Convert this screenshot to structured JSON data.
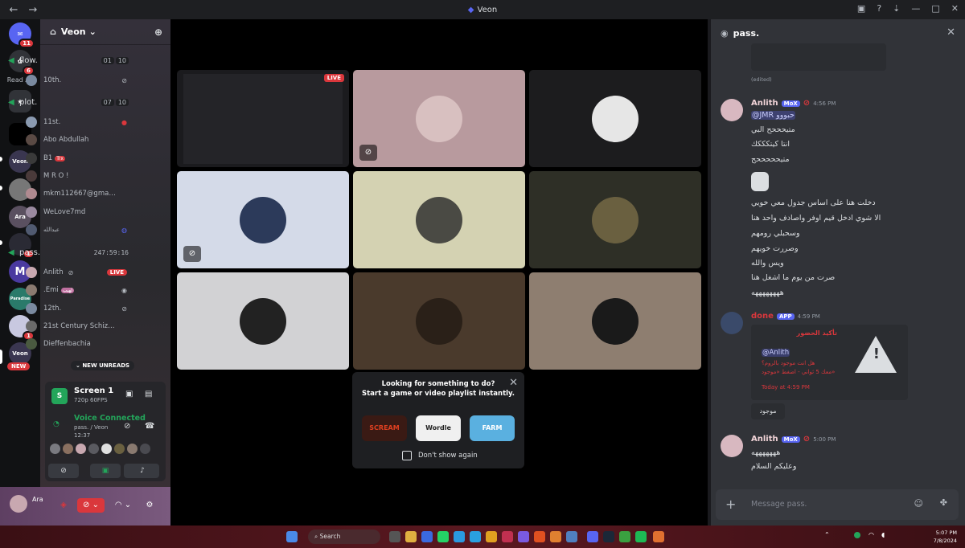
{
  "window": {
    "title": "Veon",
    "back": "←",
    "forward": "→"
  },
  "rail": {
    "readall": "Read All",
    "home_badge": "11",
    "second_badge": "6",
    "server_badges": [
      "1",
      "1"
    ],
    "new_label": "NEW",
    "labels": [
      "Veon",
      "Ara",
      "M",
      "Paradise",
      "Veon"
    ]
  },
  "server": {
    "name": "Veon"
  },
  "channels": {
    "flow": {
      "name": "flow.",
      "counts": [
        "01",
        "10"
      ]
    },
    "flow_members": [
      {
        "name": "10th."
      }
    ],
    "plot": {
      "name": "plot.",
      "counts": [
        "07",
        "10"
      ]
    },
    "plot_members": [
      {
        "name": "11st."
      },
      {
        "name": "Abo Abdullah"
      },
      {
        "name": "B1",
        "tag": "Trx"
      },
      {
        "name": "M R O !"
      },
      {
        "name": "mkm112667@gmail.c..."
      },
      {
        "name": "WeLove7md"
      },
      {
        "name": "عبدالله"
      }
    ],
    "pass": {
      "name": "pass.",
      "timer": "247:59:16"
    },
    "pass_members": [
      {
        "name": "Anlith",
        "live": "LIVE"
      },
      {
        "name": ".Emi",
        "tag": "لهيب"
      },
      {
        "name": "12th."
      },
      {
        "name": "21st Century Schizoi..."
      },
      {
        "name": "Dieffenbachia"
      }
    ],
    "new_unreads": "NEW UNREADS"
  },
  "stream_panel": {
    "thumb": "S",
    "title": "Screen 1",
    "quality": "720p 60FPS",
    "voice_status": "Voice Connected",
    "voice_channel": "pass. / Veon",
    "elapsed": "12:37"
  },
  "user": {
    "name": "Ara"
  },
  "stage": {
    "live_label": "LIVE",
    "tiles": [
      {
        "kind": "screenshare",
        "bg": "#1b1b1e"
      },
      {
        "kind": "avatar",
        "bg": "#b89a9e",
        "avatar_bg": "#d8c0c0"
      },
      {
        "kind": "avatar",
        "bg": "#1c1c1e",
        "avatar_bg": "#e6e6e6"
      },
      {
        "kind": "avatar",
        "bg": "#d4dae8",
        "avatar_bg": "#2c3a5a"
      },
      {
        "kind": "avatar",
        "bg": "#d4d2b2",
        "avatar_bg": "#4a4a44"
      },
      {
        "kind": "avatar",
        "bg": "#2e2f26",
        "avatar_bg": "#6a6040"
      },
      {
        "kind": "avatar",
        "bg": "#d2d2d4",
        "avatar_bg": "#222222"
      },
      {
        "kind": "avatar",
        "bg": "#4a3a2c",
        "avatar_bg": "#2a2018"
      },
      {
        "kind": "avatar",
        "bg": "#8e7e70",
        "avatar_bg": "#1a1a1a"
      }
    ]
  },
  "activity": {
    "line1": "Looking for something to do?",
    "line2": "Start a game or video playlist instantly.",
    "games": [
      "SCREAM",
      "Wordle",
      "FARM"
    ],
    "dont_show": "Don't show again"
  },
  "chat": {
    "channel": "pass.",
    "edited": "(edited)",
    "messages": [
      {
        "author": "Anlith",
        "role": "MoX",
        "time": "4:56 PM",
        "lines": [
          "@JMR حبووو",
          "متيحححح البي",
          "انتا كيتكككك",
          "متيحححححح",
          "",
          "دخلت هنا على اساس جدول معي خويي",
          "الا شوي ادخل قيم اوفر واصادف واحد هنا",
          "وسحبلي رومهم",
          "وصررت خويهم",
          "ويس والله",
          "صرت من يوم ما اشغل هنا",
          "ههههههههه"
        ]
      },
      {
        "author": "done",
        "role": "APP",
        "time": "4:59 PM",
        "embed": {
          "title": "تأكيد الحضور",
          "mention": "@Anlith",
          "line1": "هل انت موجود بالروم؟",
          "line2": "معك 5 ثواني - اضغط «موجود»",
          "footer": "Today at 4:59 PM"
        },
        "button": "موجود"
      },
      {
        "author": "Anlith",
        "role": "MoX",
        "time": "5:00 PM",
        "lines": [
          "هههههههه",
          "وعليكم السلام"
        ]
      }
    ],
    "placeholder": "Message pass."
  },
  "taskbar": {
    "search": "Search",
    "time": "5:07 PM",
    "date": "7/8/2024"
  },
  "colors": {
    "accent": "#5865f2",
    "live": "#da373c",
    "online": "#23a55a"
  }
}
